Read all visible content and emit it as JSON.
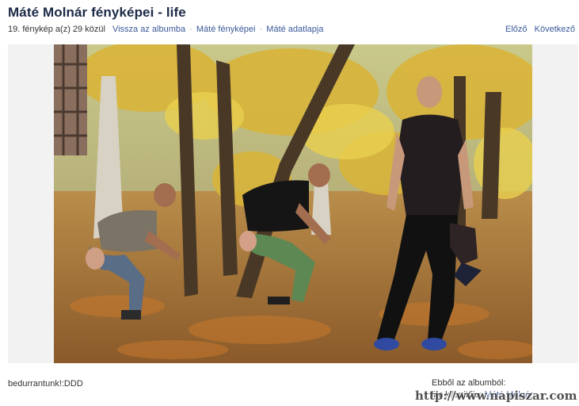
{
  "header": {
    "title": "Máté Molnár fényképei - life"
  },
  "nav": {
    "count_text": "19. fénykép a(z) 29 közül",
    "back_to_album": "Vissza az albumba",
    "photos_link": "Máté fényképei",
    "profile_link": "Máté adatlapja",
    "separator": "·",
    "prev": "Előző",
    "next": "Következő"
  },
  "photo": {
    "icon": "photo-image"
  },
  "caption": {
    "text": "bedurrantunk!:DDD"
  },
  "album_info": {
    "heading": "Ebből az albumból:",
    "line_prefix": "life készítője:",
    "author": "Máté Molnár"
  },
  "watermark": {
    "text": "http://www.napiszar.com"
  }
}
